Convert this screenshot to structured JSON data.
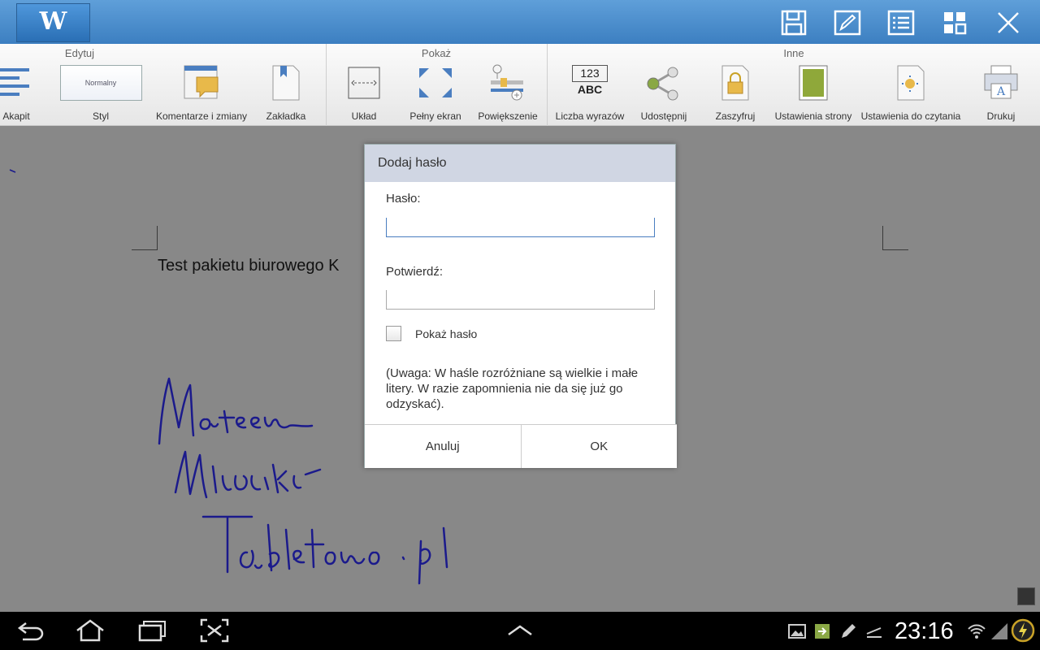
{
  "app": {
    "logo_letter": "W"
  },
  "ribbon": {
    "groups": [
      "Edytuj",
      "Pokaż",
      "Inne"
    ],
    "style_preview": "Normalny",
    "items": [
      "Akapit",
      "Styl",
      "Komentarze i zmiany",
      "Zakładka",
      "Układ",
      "Pełny ekran",
      "Powiększenie",
      "Liczba wyrazów",
      "Udostępnij",
      "Zaszyfruj",
      "Ustawienia strony",
      "Ustawienia do czytania",
      "Drukuj"
    ],
    "word_count_icon": {
      "top": "123",
      "bottom": "ABC"
    }
  },
  "document": {
    "text": "Test pakietu biurowego K",
    "handwriting": "Mateusz Wiśniewski Tabletowo.pl"
  },
  "dialog": {
    "title": "Dodaj hasło",
    "password_label": "Hasło:",
    "password_value": "",
    "confirm_label": "Potwierdź:",
    "confirm_value": "",
    "show_password_label": "Pokaż hasło",
    "show_password_checked": false,
    "note": "(Uwaga: W haśle rozróżniane są wielkie i małe litery. W razie zapomnienia nie da się już go odzyskać).",
    "cancel_label": "Anuluj",
    "ok_label": "OK"
  },
  "status": {
    "time": "23:16"
  },
  "colors": {
    "titlebar": "#4a8dcf",
    "accent": "#4a7ec0",
    "dialog_header": "#d0d6e3"
  }
}
